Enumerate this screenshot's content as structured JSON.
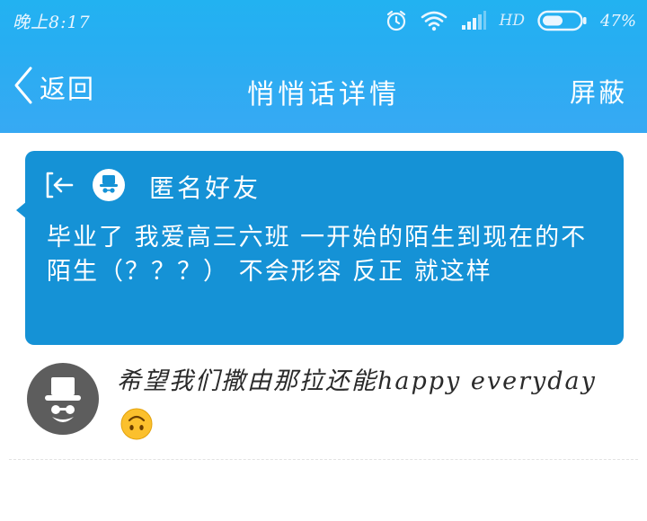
{
  "status_bar": {
    "time": "晚上8:17",
    "network": "HD",
    "battery": "47%",
    "icons": [
      "alarm-icon",
      "wifi-icon",
      "signal-icon",
      "battery-icon"
    ]
  },
  "nav": {
    "back_label": "返回",
    "title": "悄悄话详情",
    "block_label": "屏蔽"
  },
  "whisper": {
    "sender": "匿名好友",
    "message": "毕业了 我爱高三六班 一开始的陌生到现在的不陌生（？？？） 不会形容 反正 就这样"
  },
  "comment": {
    "text": "希望我们撒由那拉还能happy everyday",
    "emoji": "upside-down-face-emoji"
  },
  "colors": {
    "header_gradient_top": "#22b2f1",
    "header_gradient_bottom": "#37a9f3",
    "card_background": "#1592d6",
    "avatar_background": "#5d5d5d"
  }
}
